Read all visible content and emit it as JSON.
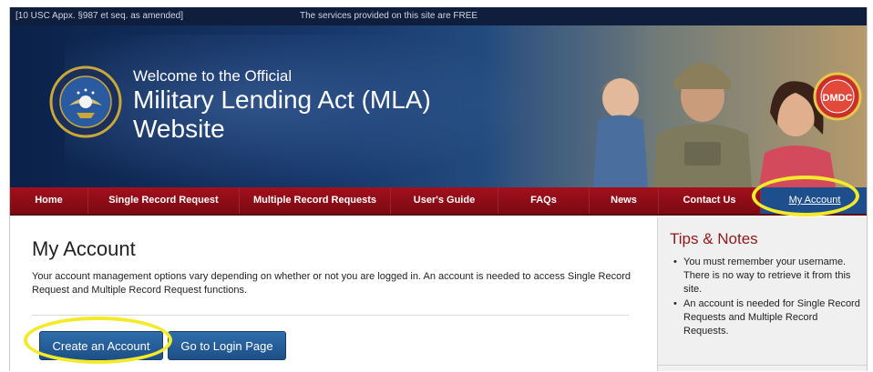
{
  "topbar": {
    "legal": "[10 USC Appx. §987 et seq. as amended]",
    "free_notice": "The services provided on this site are FREE"
  },
  "banner": {
    "welcome": "Welcome to the Official",
    "title_line1": "Military Lending Act (MLA)",
    "title_line2": "Website",
    "seal_icon": "department-of-defense-seal-icon",
    "badge_label": "DMDC"
  },
  "nav": {
    "items": [
      {
        "label": "Home"
      },
      {
        "label": "Single Record Request"
      },
      {
        "label": "Multiple Record Requests"
      },
      {
        "label": "User's Guide"
      },
      {
        "label": "FAQs"
      },
      {
        "label": "News"
      },
      {
        "label": "Contact Us"
      },
      {
        "label": "My Account"
      }
    ],
    "active": "My Account"
  },
  "main": {
    "title": "My Account",
    "intro": "Your account management options vary depending on whether or not you are logged in. An account is needed to access Single Record Request and Multiple Record Request functions.",
    "create_button": "Create an Account",
    "login_button": "Go to Login Page"
  },
  "sidebar": {
    "title": "Tips & Notes",
    "tips": [
      "You must remember your username. There is no way to retrieve it from this site.",
      "An account is needed for Single Record Requests and Multiple Record Requests."
    ]
  },
  "colors": {
    "nav_red": "#8f0e18",
    "active_blue": "#1e4f8c",
    "button_blue": "#2563a0",
    "highlight_yellow": "#f2ea2a",
    "tips_title": "#8c1a1a"
  }
}
